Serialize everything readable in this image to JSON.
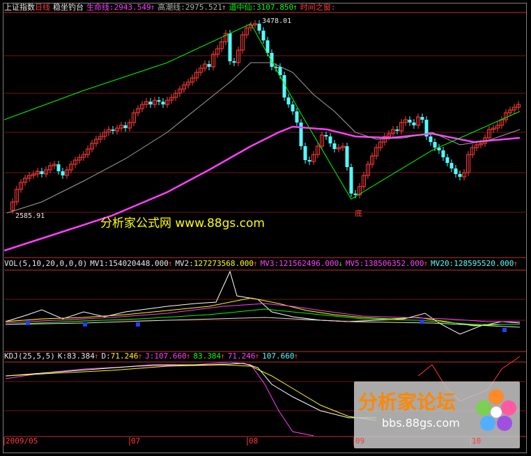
{
  "main": {
    "index_name": "上证指数",
    "period": "日线",
    "formula": "稳坐钓台",
    "life_line": {
      "label": "生命线:",
      "value": "2943.549"
    },
    "tide_line": {
      "label": "高潮线:",
      "value": "2975.521"
    },
    "dao_line": {
      "label": "道中仙:",
      "value": "3107.850"
    },
    "window_text": "时间之窗",
    "high_label": "3478.01",
    "low_label": "2585.91",
    "bottom_marker": "底"
  },
  "vol": {
    "title": "VOL(5,10,20,0,0,0)",
    "mv1": {
      "label": "MV1:",
      "value": "154020448.000"
    },
    "mv2": {
      "label": "MV2:",
      "value": "127273568.000"
    },
    "mv3": {
      "label": "MV3:",
      "value": "121562496.000"
    },
    "mv5": {
      "label": "MV5:",
      "value": "138506352.000"
    },
    "mv20": {
      "label": "MV20:",
      "value": "128595520.000"
    }
  },
  "kdj": {
    "title": "KDJ(25,5,5)",
    "k": {
      "label": "K:",
      "value": "83.384"
    },
    "d": {
      "label": "D:",
      "value": "71.246"
    },
    "j": {
      "label": "J:",
      "value": "107.660"
    },
    "k2": "83.384",
    "d2": "71.246",
    "j2": "107.660"
  },
  "axis": {
    "months": [
      "2009/05",
      "07",
      "08",
      "09",
      "10"
    ]
  },
  "watermarks": {
    "top": "分析家公式网 www.88gs.com",
    "logo_cn": "分析家论坛",
    "logo_url": "bbs.88gs.com"
  },
  "colors": {
    "up": "#ff3b3b",
    "down": "#54ffff",
    "life": "#ff40ff",
    "tide": "#a0a0a0",
    "trend": "#00ff00",
    "window": "#ff3b3b"
  }
}
